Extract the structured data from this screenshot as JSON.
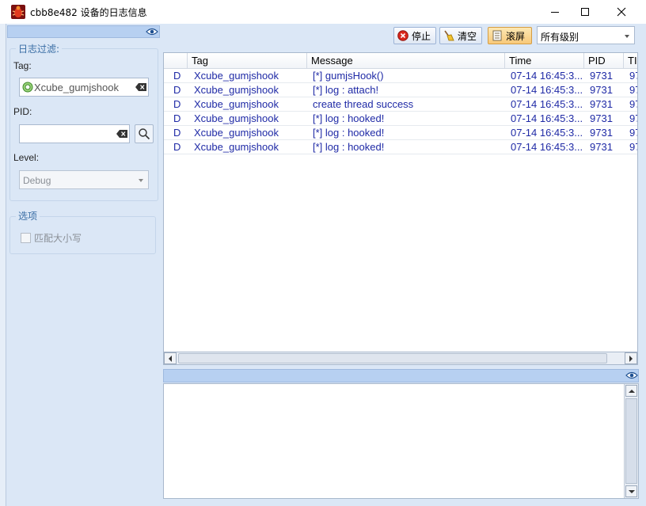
{
  "window": {
    "title": "cbb8e482 设备的日志信息"
  },
  "filter_panel": {
    "group_title": "日志过滤:",
    "tag_label": "Tag:",
    "tag_value": "Xcube_gumjshook",
    "pid_label": "PID:",
    "pid_value": "",
    "level_label": "Level:",
    "level_value": "Debug",
    "options_title": "选项",
    "match_case_label": "匹配大小写"
  },
  "toolbar": {
    "stop_label": "停止",
    "clear_label": "清空",
    "scroll_label": "滚屏",
    "level_select": "所有级别"
  },
  "grid": {
    "columns": [
      "",
      "Tag",
      "Message",
      "Time",
      "PID",
      "TI"
    ],
    "rows": [
      {
        "level": "D",
        "tag": "Xcube_gumjshook",
        "message": "[*] gumjsHook()",
        "time": "07-14 16:45:3...",
        "pid": "9731",
        "tid": "97"
      },
      {
        "level": "D",
        "tag": "Xcube_gumjshook",
        "message": "[*] log : attach!",
        "time": "07-14 16:45:3...",
        "pid": "9731",
        "tid": "97"
      },
      {
        "level": "D",
        "tag": "Xcube_gumjshook",
        "message": "create thread success",
        "time": "07-14 16:45:3...",
        "pid": "9731",
        "tid": "97"
      },
      {
        "level": "D",
        "tag": "Xcube_gumjshook",
        "message": "[*] log : hooked!",
        "time": "07-14 16:45:3...",
        "pid": "9731",
        "tid": "97"
      },
      {
        "level": "D",
        "tag": "Xcube_gumjshook",
        "message": "[*] log : hooked!",
        "time": "07-14 16:45:3...",
        "pid": "9731",
        "tid": "97"
      },
      {
        "level": "D",
        "tag": "Xcube_gumjshook",
        "message": "[*] log : hooked!",
        "time": "07-14 16:45:3...",
        "pid": "9731",
        "tid": "97"
      }
    ]
  },
  "colors": {
    "panel_bg": "#dbe7f6",
    "header_blue": "#b7d0f1",
    "row_text": "#1f2aa6",
    "group_title": "#3a6ea5"
  },
  "icons": {
    "app": "bug-icon",
    "stop": "stop-icon",
    "clear": "broom-icon",
    "scroll": "scroll-icon",
    "eye": "eye-icon",
    "search": "search-icon"
  }
}
